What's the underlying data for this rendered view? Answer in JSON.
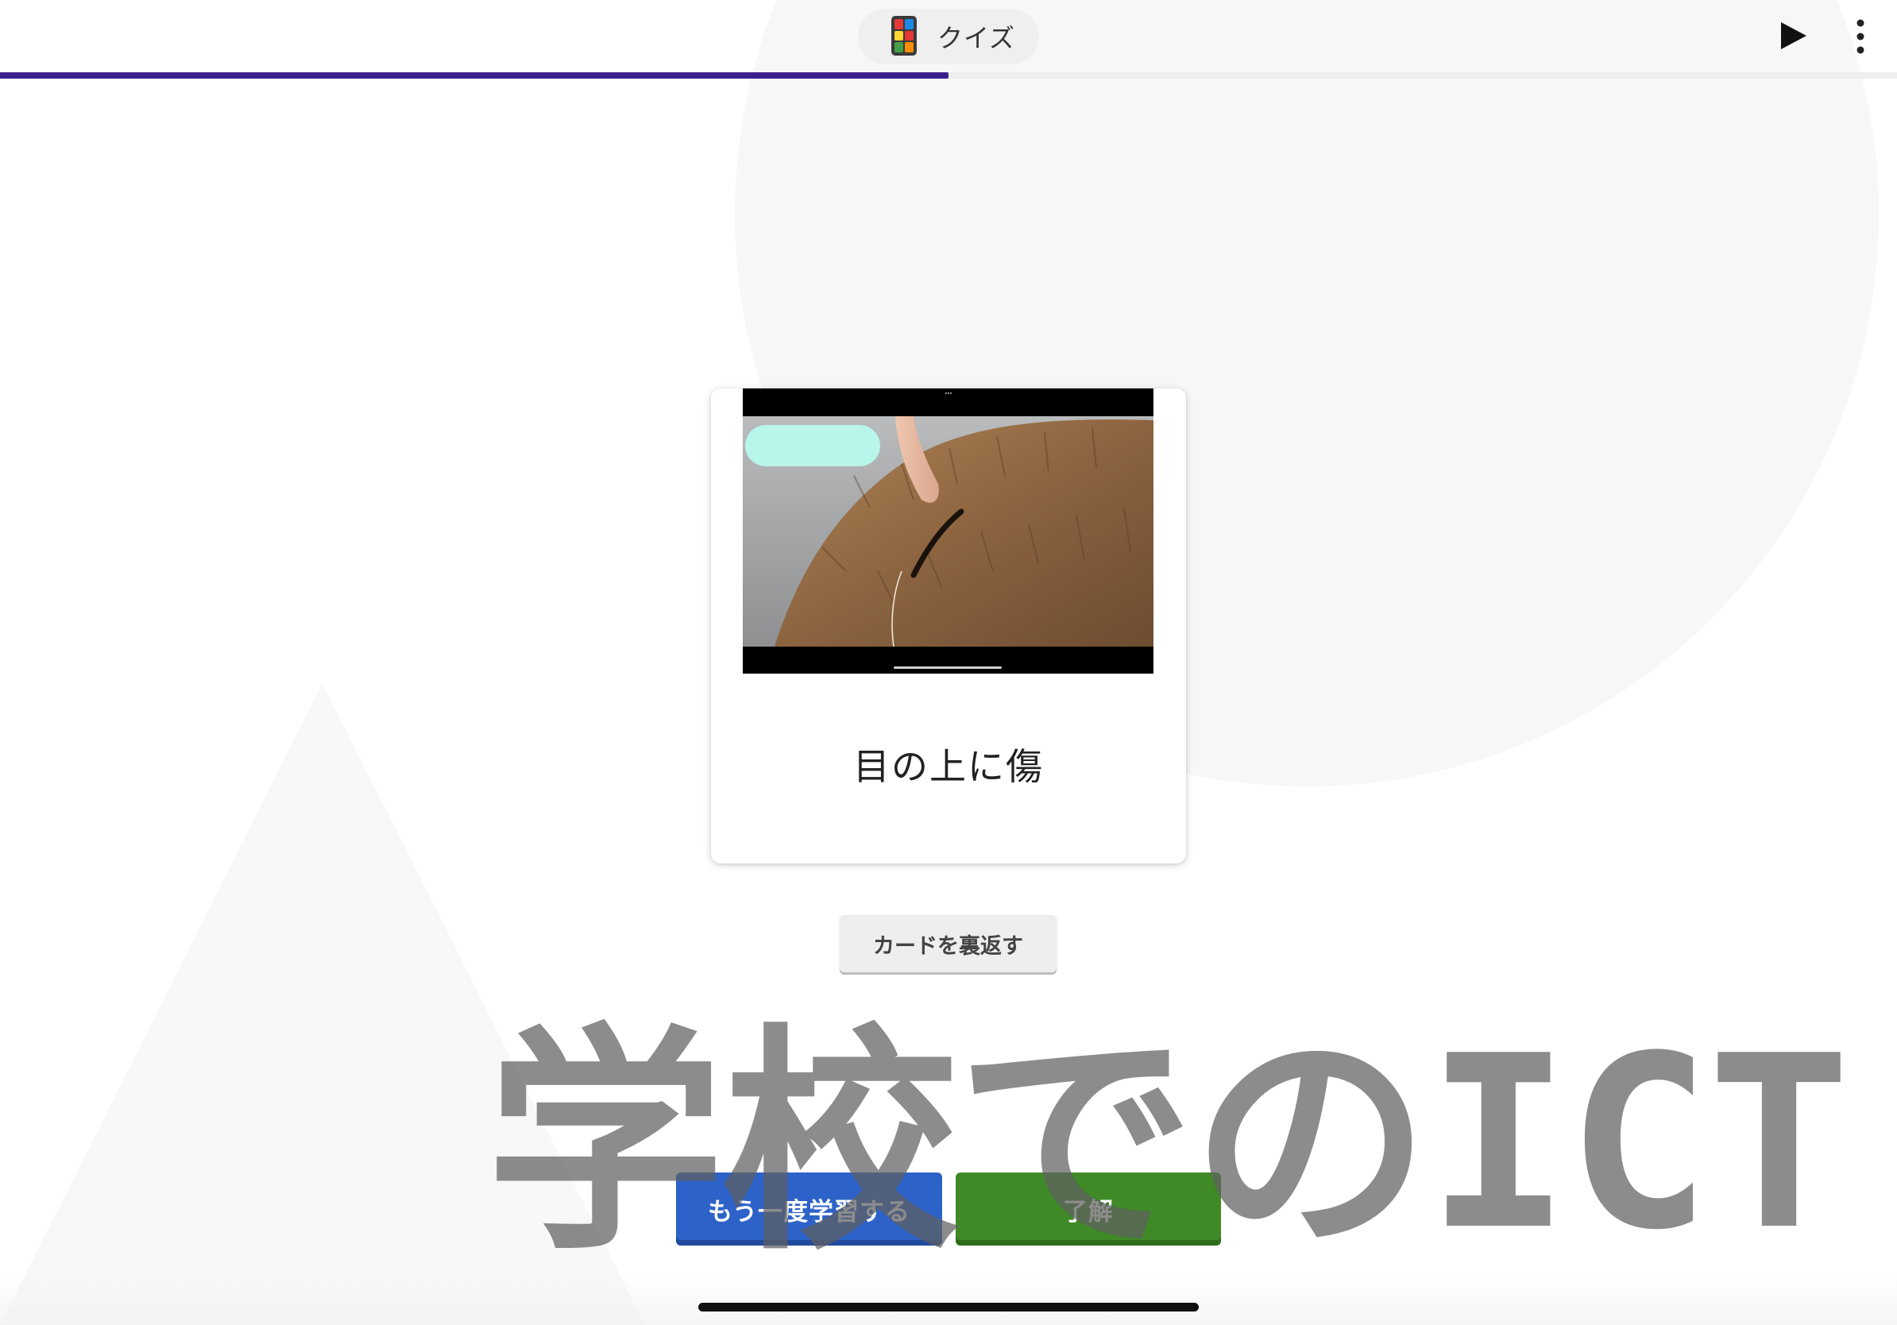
{
  "header": {
    "title": "クイズ",
    "logo_icon": "quiz-app-logo-icon",
    "play_icon": "play-icon",
    "menu_icon": "more-vertical-icon"
  },
  "progress": {
    "fraction": 0.5,
    "color": "#3b1f8f"
  },
  "card": {
    "media_icon": "capybara-photo",
    "text": "目の上に傷"
  },
  "actions": {
    "flip_label": "カードを裏返す",
    "retry_label": "もう一度学習する",
    "ok_label": "了解",
    "retry_color": "#2d63c8",
    "ok_color": "#3f8a27"
  },
  "watermark": {
    "text": "学校でのICT"
  }
}
